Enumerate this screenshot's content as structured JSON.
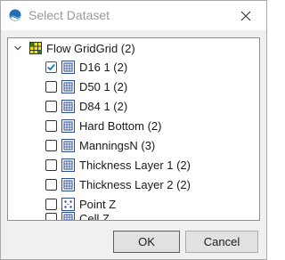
{
  "window": {
    "title": "Select Dataset"
  },
  "tree": {
    "root": {
      "label": "Flow GridGrid (2)",
      "expanded": true,
      "icon": "grid-icon"
    },
    "items": [
      {
        "label": "D16 1 (2)",
        "checked": true,
        "icon": "dataset-icon"
      },
      {
        "label": "D50 1 (2)",
        "checked": false,
        "icon": "dataset-icon"
      },
      {
        "label": "D84 1 (2)",
        "checked": false,
        "icon": "dataset-icon"
      },
      {
        "label": "Hard Bottom (2)",
        "checked": false,
        "icon": "dataset-icon"
      },
      {
        "label": "ManningsN (3)",
        "checked": false,
        "icon": "dataset-icon"
      },
      {
        "label": "Thickness Layer 1 (2)",
        "checked": false,
        "icon": "dataset-icon"
      },
      {
        "label": "Thickness Layer 2 (2)",
        "checked": false,
        "icon": "dataset-icon"
      },
      {
        "label": "Point Z",
        "checked": false,
        "icon": "point-dataset-icon"
      },
      {
        "label": "Cell Z",
        "checked": false,
        "icon": "dataset-icon"
      }
    ]
  },
  "buttons": {
    "ok": "OK",
    "cancel": "Cancel"
  },
  "colors": {
    "accent": "#0067c0",
    "title_text": "#999999"
  }
}
